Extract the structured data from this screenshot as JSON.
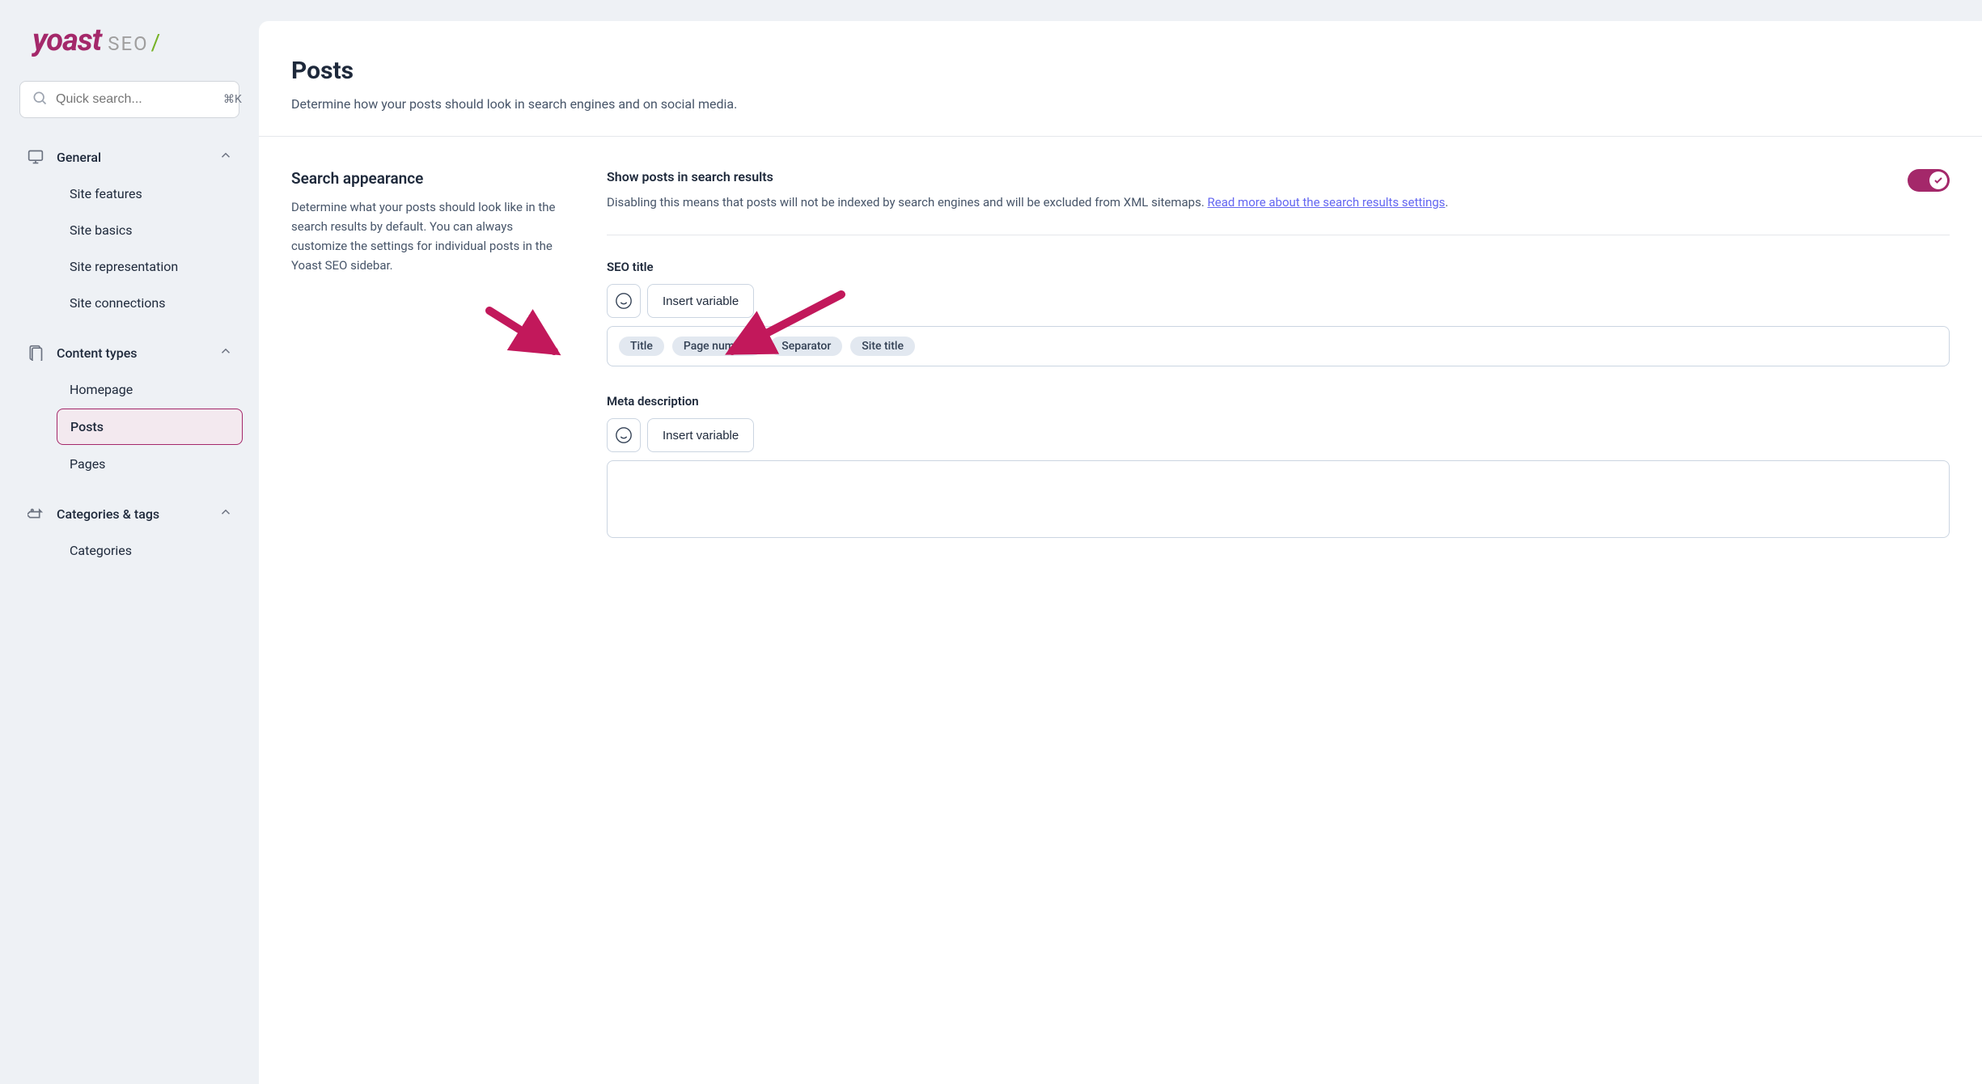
{
  "brand": {
    "name": "yoast",
    "suffix": "SEO",
    "slash": "/"
  },
  "search": {
    "placeholder": "Quick search...",
    "shortcut": "⌘K"
  },
  "nav": {
    "general": {
      "label": "General",
      "items": [
        "Site features",
        "Site basics",
        "Site representation",
        "Site connections"
      ]
    },
    "content_types": {
      "label": "Content types",
      "items": [
        "Homepage",
        "Posts",
        "Pages"
      ],
      "active": "Posts"
    },
    "categories_tags": {
      "label": "Categories & tags",
      "items": [
        "Categories"
      ]
    }
  },
  "header": {
    "title": "Posts",
    "subtitle": "Determine how your posts should look in search engines and on social media."
  },
  "section": {
    "title": "Search appearance",
    "desc": "Determine what your posts should look like in the search results by default. You can always customize the settings for individual posts in the Yoast SEO sidebar."
  },
  "show_setting": {
    "title": "Show posts in search results",
    "desc_prefix": "Disabling this means that posts will not be indexed by search engines and will be excluded from XML sitemaps. ",
    "link": "Read more about the search results settings",
    "desc_suffix": "."
  },
  "seo_title": {
    "label": "SEO title",
    "insert": "Insert variable",
    "pills": [
      "Title",
      "Page number",
      "Separator",
      "Site title"
    ]
  },
  "meta_desc": {
    "label": "Meta description",
    "insert": "Insert variable"
  }
}
